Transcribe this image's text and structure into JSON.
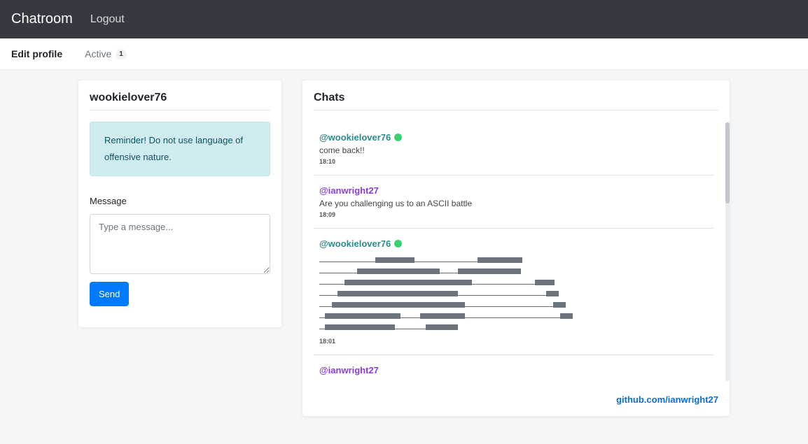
{
  "navbar": {
    "brand": "Chatroom",
    "logout": "Logout"
  },
  "subnav": {
    "edit_profile": "Edit profile",
    "active_label": "Active",
    "active_count": "1"
  },
  "profile": {
    "username": "wookielover76",
    "alert": "Reminder! Do not use language of offensive nature.",
    "message_label": "Message",
    "message_placeholder": "Type a message...",
    "send_label": "Send"
  },
  "chats": {
    "title": "Chats",
    "messages": [
      {
        "user": "@wookielover76",
        "online": true,
        "text": "come back!!",
        "time": "18:10"
      },
      {
        "user": "@ianwright27",
        "online": false,
        "text": "Are you challenging us to an ASCII battle",
        "time": "18:09"
      },
      {
        "user": "@wookielover76",
        "online": true,
        "text": "",
        "time": "18:01"
      },
      {
        "user": "@ianwright27",
        "online": false,
        "text": "",
        "time": ""
      }
    ],
    "footer_link": "github.com/ianwright27"
  },
  "colors": {
    "navbar": "#343a40",
    "primary": "#007bff",
    "alert_bg": "#d1ecf1",
    "online": "#3cd070",
    "teal_user": "#2a8a8a",
    "purple_user": "#8a3fd8"
  }
}
